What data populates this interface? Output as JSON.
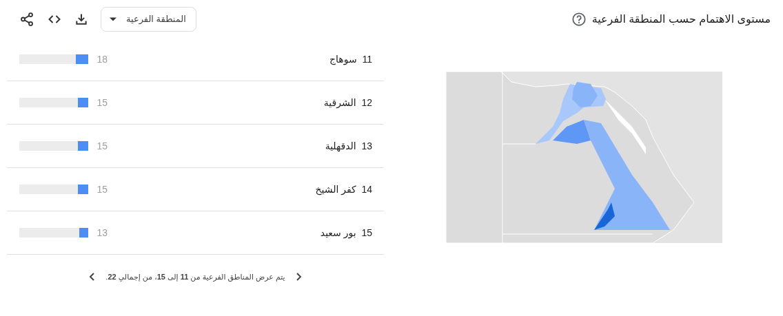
{
  "title": "مستوى الاهتمام حسب المنطقة الفرعية",
  "dropdown": {
    "label": "المنطقة الفرعية"
  },
  "rows": [
    {
      "rank": "11",
      "name": "سوهاج",
      "value": "18",
      "level": 0.18
    },
    {
      "rank": "12",
      "name": "الشرقية",
      "value": "15",
      "level": 0.15
    },
    {
      "rank": "13",
      "name": "الدقهلية",
      "value": "15",
      "level": 0.15
    },
    {
      "rank": "14",
      "name": "كفر الشيخ",
      "value": "15",
      "level": 0.15
    },
    {
      "rank": "15",
      "name": "بور سعيد",
      "value": "13",
      "level": 0.13
    }
  ],
  "pagination": {
    "text": "يتم عرض المناطق الفرعية من **11** إلى **15**، من إجمالي **22**."
  }
}
